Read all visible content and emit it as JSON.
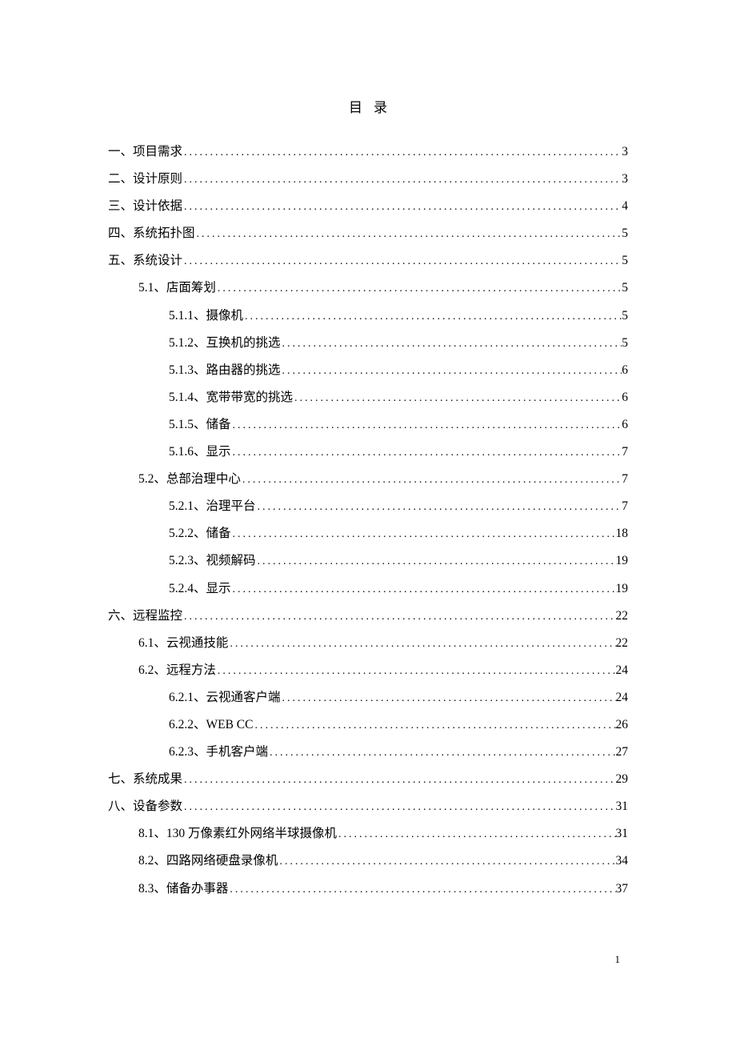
{
  "title": "目录",
  "page_number": "1",
  "toc": [
    {
      "level": 0,
      "label": "一、项目需求",
      "page": "3"
    },
    {
      "level": 0,
      "label": "二、设计原则",
      "page": "3"
    },
    {
      "level": 0,
      "label": "三、设计依据",
      "page": "4"
    },
    {
      "level": 0,
      "label": "四、系统拓扑图",
      "page": "5"
    },
    {
      "level": 0,
      "label": "五、系统设计",
      "page": "5"
    },
    {
      "level": 1,
      "label": "5.1、店面筹划",
      "page": "5"
    },
    {
      "level": 2,
      "label": "5.1.1、摄像机",
      "page": "5"
    },
    {
      "level": 2,
      "label": "5.1.2、互换机的挑选",
      "page": "5"
    },
    {
      "level": 2,
      "label": "5.1.3、路由器的挑选",
      "page": "6"
    },
    {
      "level": 2,
      "label": "5.1.4、宽带带宽的挑选",
      "page": "6"
    },
    {
      "level": 2,
      "label": "5.1.5、储备",
      "page": "6"
    },
    {
      "level": 2,
      "label": "5.1.6、显示",
      "page": "7"
    },
    {
      "level": 1,
      "label": "5.2、总部治理中心",
      "page": "7"
    },
    {
      "level": 2,
      "label": "5.2.1、治理平台",
      "page": "7"
    },
    {
      "level": 2,
      "label": "5.2.2、储备",
      "page": "18"
    },
    {
      "level": 2,
      "label": "5.2.3、视频解码",
      "page": "19"
    },
    {
      "level": 2,
      "label": "5.2.4、显示",
      "page": "19"
    },
    {
      "level": 0,
      "label": "六、远程监控",
      "page": "22"
    },
    {
      "level": 1,
      "label": "6.1、云视通技能",
      "page": "22"
    },
    {
      "level": 1,
      "label": "6.2、远程方法",
      "page": "24"
    },
    {
      "level": 2,
      "label": "6.2.1、云视通客户端",
      "page": "24"
    },
    {
      "level": 2,
      "label": "6.2.2、WEB CC",
      "page": "26"
    },
    {
      "level": 2,
      "label": "6.2.3、手机客户端",
      "page": "27"
    },
    {
      "level": 0,
      "label": "七、系统成果",
      "page": "29"
    },
    {
      "level": 0,
      "label": "八、设备参数",
      "page": "31"
    },
    {
      "level": 1,
      "label": "8.1、130 万像素红外网络半球摄像机 ",
      "page": "31"
    },
    {
      "level": 1,
      "label": "8.2、四路网络硬盘录像机",
      "page": "34"
    },
    {
      "level": 1,
      "label": "8.3、储备办事器",
      "page": "37"
    }
  ]
}
